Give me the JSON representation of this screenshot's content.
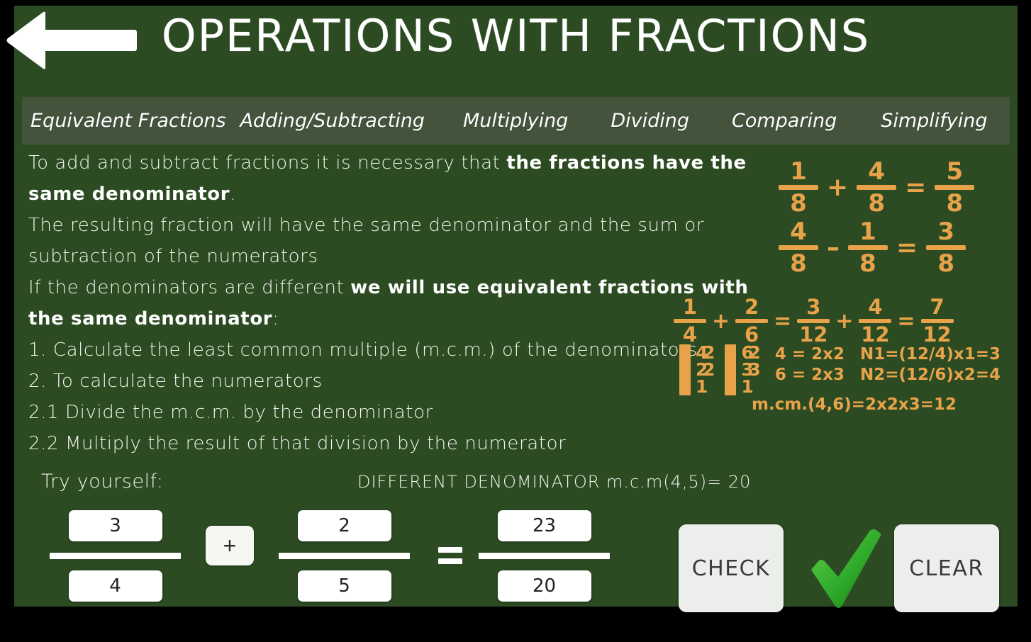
{
  "header": {
    "title": "OPERATIONS WITH FRACTIONS",
    "back_label": "back-arrow"
  },
  "tabs": [
    {
      "label": "Equivalent Fractions"
    },
    {
      "label": "Adding/Subtracting"
    },
    {
      "label": "Multiplying"
    },
    {
      "label": "Dividing"
    },
    {
      "label": "Comparing"
    },
    {
      "label": "Simplifying"
    }
  ],
  "lesson": {
    "line1_plain": "To add and subtract fractions it is necessary that ",
    "line1_bold": "the fractions have the same denominator",
    "line1_end": ".",
    "line2": "The resulting fraction will have the same denominator and the sum or subtraction of the numerators",
    "line3_plain": "If the denominators are different ",
    "line3_bold": "we will use equivalent fractions with the same denominator",
    "line3_end": ":",
    "step1": "1. Calculate the least common multiple (m.c.m.) of the denominators.",
    "step2": "2. To calculate the numerators",
    "step2_1": "2.1 Divide the m.c.m. by the denominator",
    "step2_2": "2.2 Multiply the result of that division by the numerator"
  },
  "examples": {
    "same_denominator": [
      {
        "a_num": "1",
        "a_den": "8",
        "op": "+",
        "b_num": "4",
        "b_den": "8",
        "eq": "=",
        "r_num": "5",
        "r_den": "8"
      },
      {
        "a_num": "4",
        "a_den": "8",
        "op": "–",
        "b_num": "1",
        "b_den": "8",
        "eq": "=",
        "r_num": "3",
        "r_den": "8"
      }
    ],
    "different_denominator": {
      "a_num": "1",
      "a_den": "4",
      "op1": "+",
      "b_num": "2",
      "b_den": "6",
      "eq1": "=",
      "c_num": "3",
      "c_den": "12",
      "op2": "+",
      "d_num": "4",
      "d_den": "12",
      "eq2": "=",
      "r_num": "7",
      "r_den": "12"
    },
    "ladder_left": {
      "r1a": "4",
      "r1b": "2",
      "r2a": "2",
      "r2b": "2",
      "r3a": "1",
      "r3b": ""
    },
    "ladder_right": {
      "r1a": "6",
      "r1b": "2",
      "r2a": "3",
      "r2b": "3",
      "r3a": "1",
      "r3b": ""
    },
    "factor_4": "4 = 2x2",
    "factor_6": "6 = 2x3",
    "n1": "N1=(12/4)x1=3",
    "n2": "N2=(12/6)x2=4",
    "mcm": "m.cm.(4,6)=2x2x3=12"
  },
  "practice": {
    "try_label": "Try yourself:",
    "hint": "DIFFERENT DENOMINATOR m.c.m(4,5)= 20",
    "fraction1": {
      "numerator": "3",
      "denominator": "4"
    },
    "operator": "+",
    "fraction2": {
      "numerator": "2",
      "denominator": "5"
    },
    "equals": "=",
    "result": {
      "numerator": "23",
      "denominator": "20"
    },
    "check_label": "CHECK",
    "clear_label": "CLEAR",
    "feedback": "correct-checkmark"
  },
  "colors": {
    "board_green": "#2c4b22",
    "tabbar_green": "#44543c",
    "chalk_white": "#f2f5ee",
    "chalk_orange": "#e8a34a",
    "correct_green": "#34b233"
  }
}
